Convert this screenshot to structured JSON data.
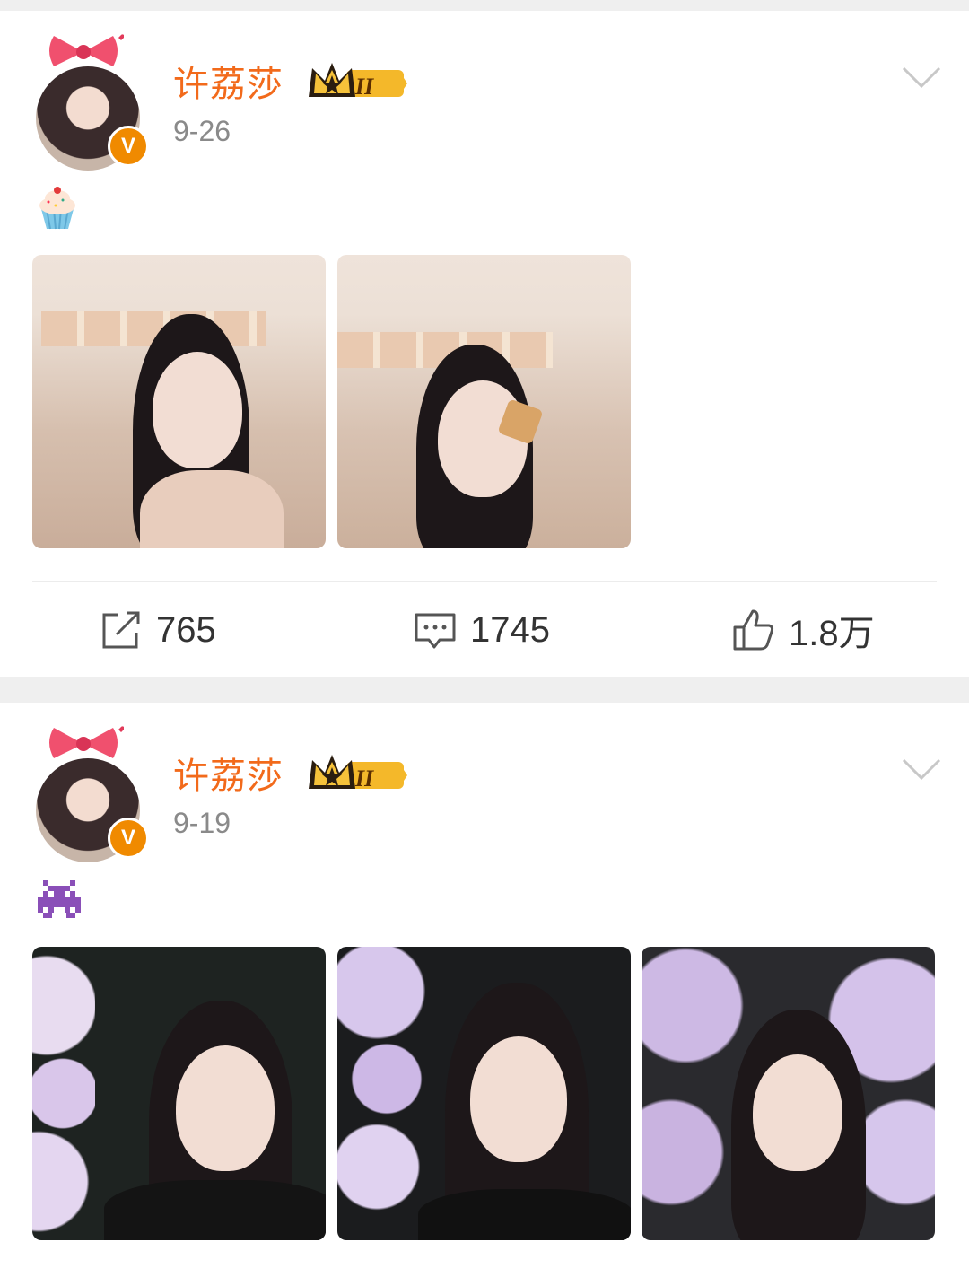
{
  "posts": [
    {
      "author": "许荔莎",
      "date": "9-26",
      "emoji": "cupcake",
      "verified_badge": "V",
      "level_badge": "II",
      "photo_count": 2,
      "stats": {
        "reposts": "765",
        "comments": "1745",
        "likes": "1.8万"
      }
    },
    {
      "author": "许荔莎",
      "date": "9-19",
      "emoji": "alien-monster",
      "verified_badge": "V",
      "level_badge": "II",
      "photo_count": 3
    }
  ],
  "colors": {
    "username": "#f26a1b",
    "badge_orange": "#f08a00",
    "page_bg": "#efefef"
  }
}
